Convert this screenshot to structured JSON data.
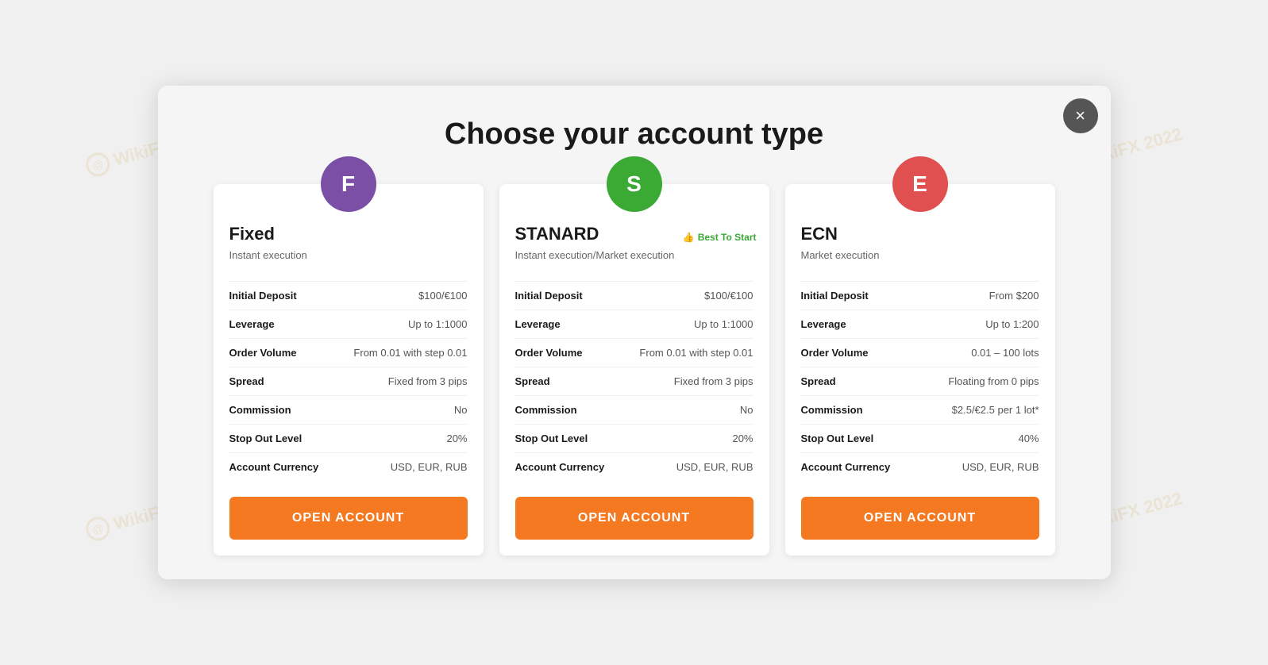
{
  "page": {
    "title": "Choose your account type",
    "close_icon": "×"
  },
  "cards": [
    {
      "id": "fixed",
      "icon_letter": "F",
      "icon_color": "purple",
      "name": "Fixed",
      "subtitle": "Instant execution",
      "best_badge": null,
      "rows": [
        {
          "label": "Initial Deposit",
          "value": "$100/€100"
        },
        {
          "label": "Leverage",
          "value": "Up to 1:1000"
        },
        {
          "label": "Order Volume",
          "value": "From 0.01 with step 0.01"
        },
        {
          "label": "Spread",
          "value": "Fixed from 3 pips"
        },
        {
          "label": "Commission",
          "value": "No"
        },
        {
          "label": "Stop Out Level",
          "value": "20%"
        },
        {
          "label": "Account Currency",
          "value": "USD, EUR, RUB"
        }
      ],
      "button_label": "OPEN ACCOUNT"
    },
    {
      "id": "standard",
      "icon_letter": "S",
      "icon_color": "green",
      "name": "STANARD",
      "subtitle": "Instant execution/Market execution",
      "best_badge": "Best To Start",
      "rows": [
        {
          "label": "Initial Deposit",
          "value": "$100/€100"
        },
        {
          "label": "Leverage",
          "value": "Up to 1:1000"
        },
        {
          "label": "Order Volume",
          "value": "From 0.01 with step 0.01"
        },
        {
          "label": "Spread",
          "value": "Fixed from 3 pips"
        },
        {
          "label": "Commission",
          "value": "No"
        },
        {
          "label": "Stop Out Level",
          "value": "20%"
        },
        {
          "label": "Account Currency",
          "value": "USD, EUR, RUB"
        }
      ],
      "button_label": "OPEN ACCOUNT"
    },
    {
      "id": "ecn",
      "icon_letter": "E",
      "icon_color": "red",
      "name": "ECN",
      "subtitle": "Market execution",
      "best_badge": null,
      "rows": [
        {
          "label": "Initial Deposit",
          "value": "From $200"
        },
        {
          "label": "Leverage",
          "value": "Up to 1:200"
        },
        {
          "label": "Order Volume",
          "value": "0.01 – 100 lots"
        },
        {
          "label": "Spread",
          "value": "Floating from 0 pips"
        },
        {
          "label": "Commission",
          "value": "$2.5/€2.5 per 1 lot*"
        },
        {
          "label": "Stop Out Level",
          "value": "40%"
        },
        {
          "label": "Account Currency",
          "value": "USD, EUR, RUB"
        }
      ],
      "button_label": "OPEN ACCOUNT"
    }
  ],
  "watermark": {
    "text": "WikiFX",
    "year": "2022"
  }
}
